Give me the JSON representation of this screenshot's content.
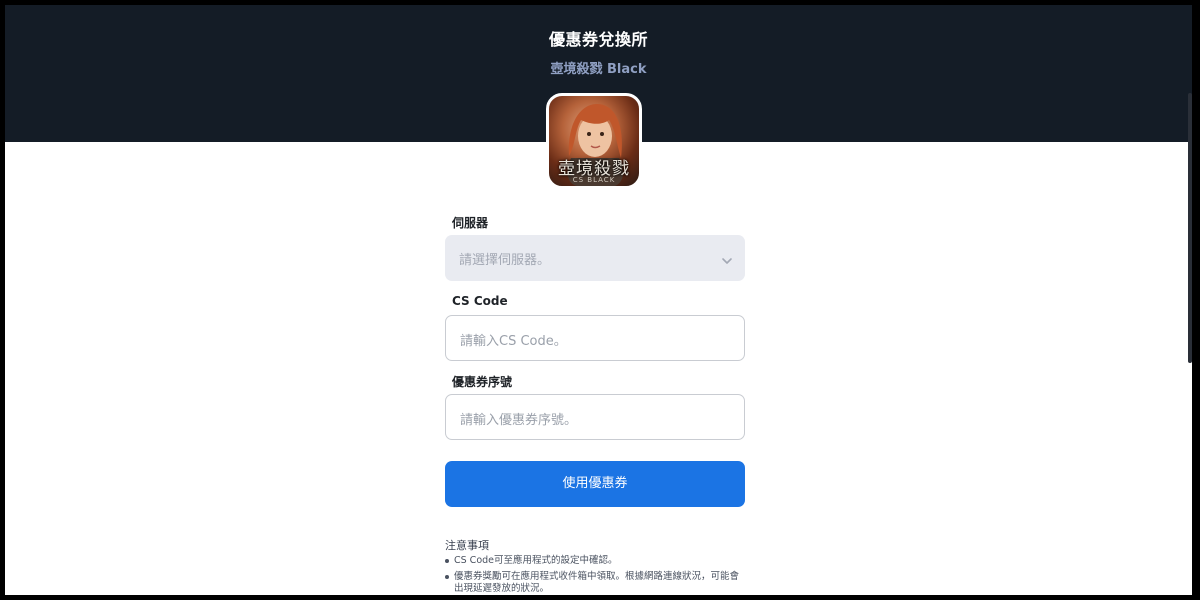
{
  "header": {
    "title": "優惠券兌換所",
    "subtitle": "壺境殺戮 Black",
    "logo": {
      "text": "壺境殺戮",
      "sub": "CS BLACK",
      "icon": "game-logo"
    }
  },
  "form": {
    "server": {
      "label": "伺服器",
      "placeholder": "請選擇伺服器。"
    },
    "cs_code": {
      "label": "CS Code",
      "placeholder": "請輸入CS Code。"
    },
    "coupon": {
      "label": "優惠券序號",
      "placeholder": "請輸入優惠券序號。"
    },
    "submit_label": "使用優惠券"
  },
  "notes": {
    "title": "注意事項",
    "items": [
      "CS Code可至應用程式的設定中確認。",
      "優惠券獎勵可在應用程式收件箱中領取。根據網路連線狀況，可能會出現延遲發放的狀況。"
    ]
  },
  "colors": {
    "header_bg": "#141c26",
    "accent": "#1b74e4",
    "subtitle": "#8f9fc2"
  }
}
